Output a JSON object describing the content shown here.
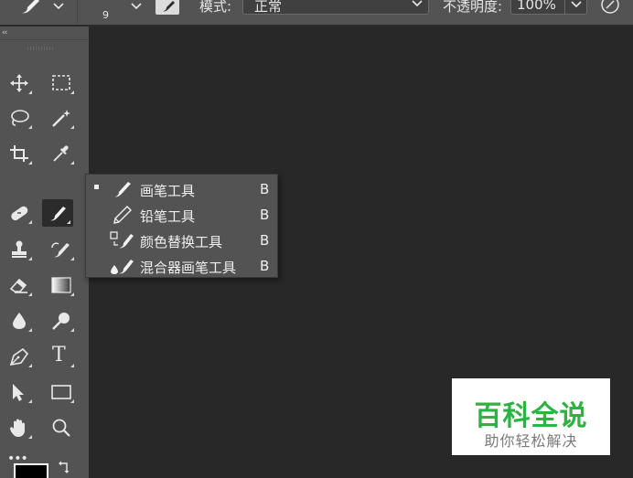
{
  "options_bar": {
    "brush_size": "9",
    "mode_label": "模式:",
    "mode_value": "正常",
    "opacity_label": "不透明度:",
    "opacity_value": "100%"
  },
  "toolbar": {
    "collapse_label": "‹‹",
    "tools": [
      "move-tool",
      "marquee-tool",
      "lasso-tool",
      "magic-wand-tool",
      "crop-tool",
      "eyedropper-tool",
      "healing-brush-tool",
      "brush-tool",
      "clone-stamp-tool",
      "history-brush-tool",
      "eraser-tool",
      "gradient-tool",
      "blur-tool",
      "dodge-tool",
      "pen-tool",
      "type-tool",
      "path-selection-tool",
      "rectangle-tool",
      "hand-tool",
      "zoom-tool",
      "more-tools"
    ],
    "type_tool_glyph": "T",
    "more_tools_glyph": "•••",
    "active_tool": "brush-tool",
    "foreground_color": "#000000"
  },
  "flyout": {
    "items": [
      {
        "label": "画笔工具",
        "shortcut": "B",
        "icon": "brush-icon",
        "selected": true
      },
      {
        "label": "铅笔工具",
        "shortcut": "B",
        "icon": "pencil-icon",
        "selected": false
      },
      {
        "label": "颜色替换工具",
        "shortcut": "B",
        "icon": "color-replacement-icon",
        "selected": false
      },
      {
        "label": "混合器画笔工具",
        "shortcut": "B",
        "icon": "mixer-brush-icon",
        "selected": false
      }
    ]
  },
  "watermark": {
    "title": "百科全说",
    "subtitle": "助你轻松解决"
  },
  "colors": {
    "panel": "#535353",
    "canvas": "#282828",
    "watermark_green": "#2db243"
  }
}
